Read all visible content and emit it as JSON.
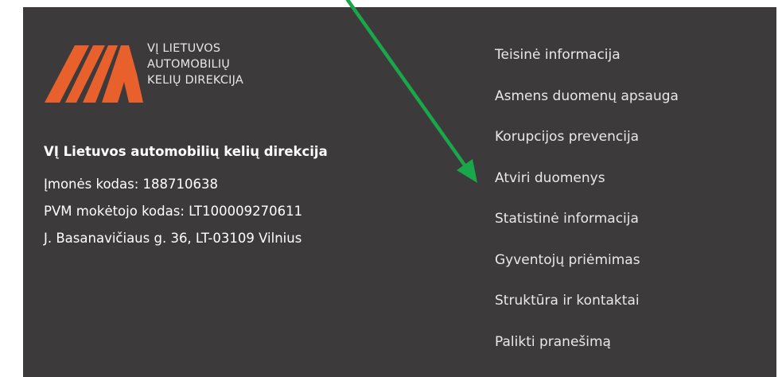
{
  "logo": {
    "lines": [
      "VĮ LIETUVOS",
      "AUTOMOBILIŲ",
      "KELIŲ DIREKCIJA"
    ],
    "color": "#e8612c"
  },
  "company": {
    "name": "VĮ Lietuvos automobilių kelių direkcija",
    "code": "Įmonės kodas: 188710638",
    "vat": "PVM mokėtojo kodas: LT100009270611",
    "address": "J. Basanavičiaus g. 36, LT-03109 Vilnius"
  },
  "links": [
    "Teisinė informacija",
    "Asmens duomenų apsauga",
    "Korupcijos prevencija",
    "Atviri duomenys",
    "Statistinė informacija",
    "Gyventojų priėmimas",
    "Struktūra ir kontaktai",
    "Palikti pranešimą"
  ],
  "annotation": {
    "arrow_color": "#1aa64a",
    "arrow_target": "Atviri duomenys"
  },
  "colors": {
    "footer_bg": "#3d3a3b",
    "text": "#e8e8e8"
  }
}
